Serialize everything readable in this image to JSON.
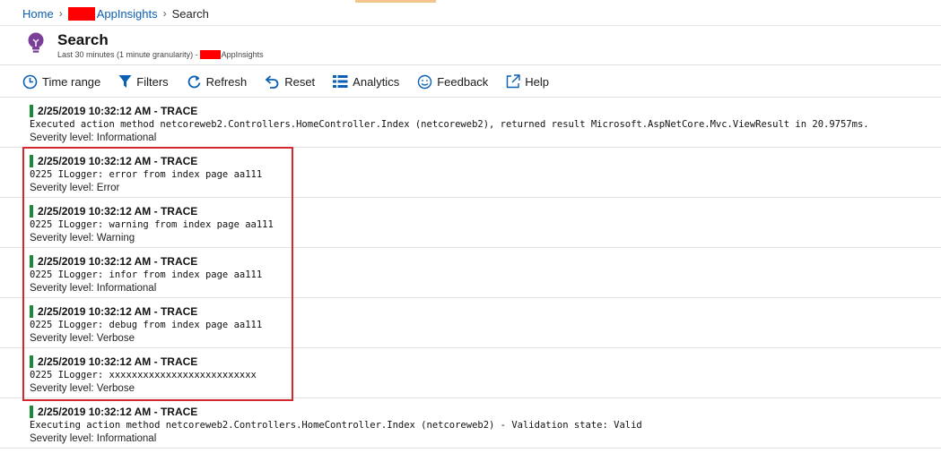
{
  "breadcrumb": {
    "home": "Home",
    "resource": "AppInsights",
    "current": "Search"
  },
  "header": {
    "title": "Search",
    "subtitle_prefix": "Last 30 minutes (1 minute granularity) -",
    "subtitle_resource": "AppInsights",
    "icon": "lightbulb-icon"
  },
  "toolbar": {
    "time_range": "Time range",
    "filters": "Filters",
    "refresh": "Refresh",
    "reset": "Reset",
    "analytics": "Analytics",
    "feedback": "Feedback",
    "help": "Help"
  },
  "colors": {
    "link": "#0b5fb4",
    "marker_green": "#1a8a3a",
    "highlight_red": "#d6262e",
    "redaction": "#ff0000"
  },
  "results": [
    {
      "title": "2/25/2019 10:32:12 AM - TRACE",
      "message": "Executed action method netcoreweb2.Controllers.HomeController.Index (netcoreweb2), returned result Microsoft.AspNetCore.Mvc.ViewResult in 20.9757ms.",
      "severity": "Severity level: Informational"
    },
    {
      "title": "2/25/2019 10:32:12 AM - TRACE",
      "message": "0225 ILogger: error from index page aa111",
      "severity": "Severity level: Error"
    },
    {
      "title": "2/25/2019 10:32:12 AM - TRACE",
      "message": "0225 ILogger: warning from index page aa111",
      "severity": "Severity level: Warning"
    },
    {
      "title": "2/25/2019 10:32:12 AM - TRACE",
      "message": "0225 ILogger: infor from index page aa111",
      "severity": "Severity level: Informational"
    },
    {
      "title": "2/25/2019 10:32:12 AM - TRACE",
      "message": "0225 ILogger: debug from index page aa111",
      "severity": "Severity level: Verbose"
    },
    {
      "title": "2/25/2019 10:32:12 AM - TRACE",
      "message": "0225 ILogger: xxxxxxxxxxxxxxxxxxxxxxxxxx",
      "severity": "Severity level: Verbose"
    },
    {
      "title": "2/25/2019 10:32:12 AM - TRACE",
      "message": "Executing action method netcoreweb2.Controllers.HomeController.Index (netcoreweb2) - Validation state: Valid",
      "severity": "Severity level: Informational"
    }
  ]
}
